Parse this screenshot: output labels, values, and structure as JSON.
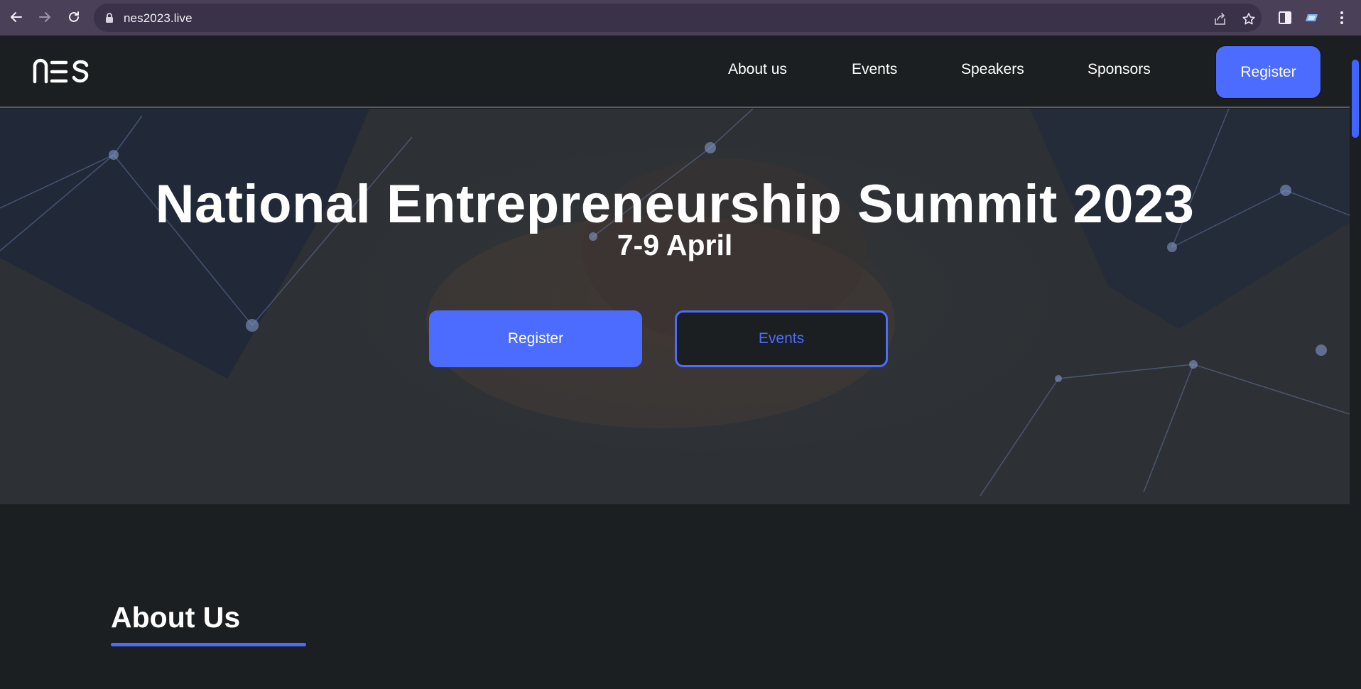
{
  "browser": {
    "url": "nes2023.live",
    "icons": [
      "back-arrow-icon",
      "forward-arrow-icon",
      "reload-icon",
      "lock-icon",
      "share-icon",
      "star-icon",
      "side-panel-icon",
      "extension-icon",
      "kebab-menu-icon"
    ]
  },
  "header": {
    "logo_text": "nes",
    "nav": [
      {
        "label": "About us"
      },
      {
        "label": "Events"
      },
      {
        "label": "Speakers"
      },
      {
        "label": "Sponsors"
      }
    ],
    "register_label": "Register"
  },
  "hero": {
    "title": "National Entrepreneurship Summit 2023",
    "date": "7-9 April",
    "primary_button": "Register",
    "secondary_button": "Events"
  },
  "about": {
    "heading": "About Us"
  },
  "colors": {
    "accent": "#4b6cff",
    "page_bg": "#1c1f21",
    "chrome_bg": "#4a4159",
    "text": "#ffffff"
  }
}
